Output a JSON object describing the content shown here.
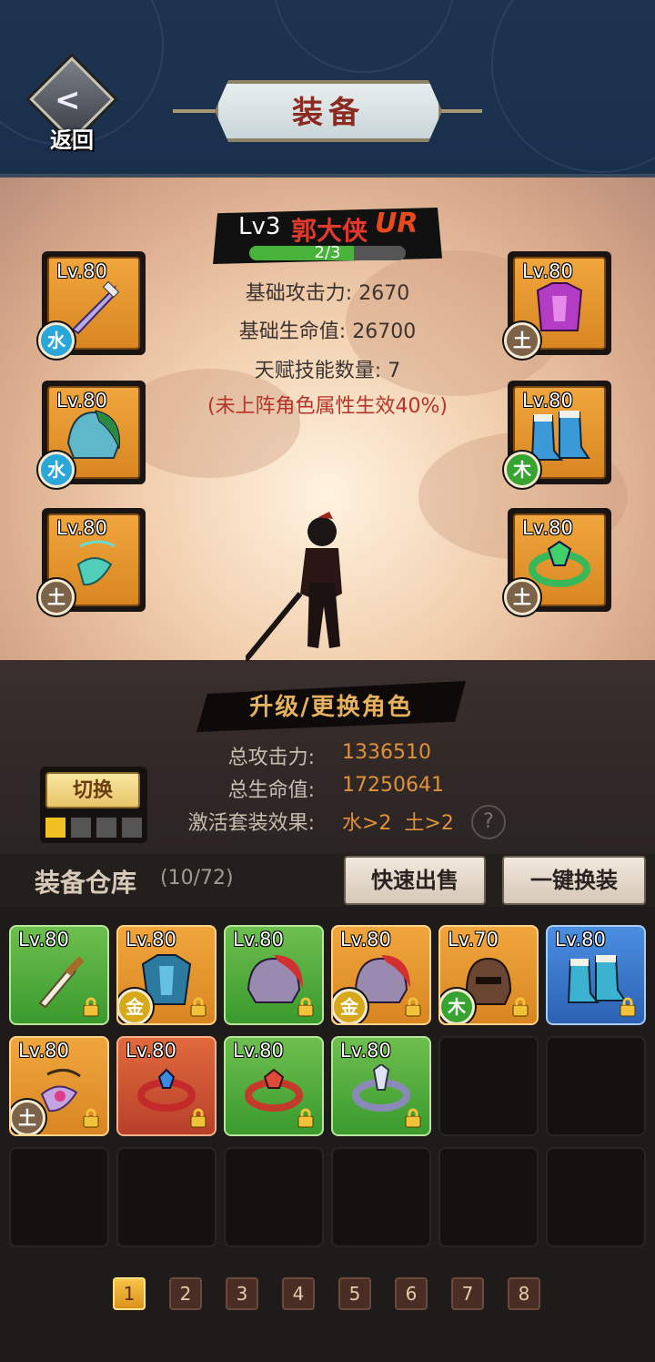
{
  "header": {
    "title": "装备",
    "back_label": "返回"
  },
  "hero": {
    "level": "Lv3",
    "name": "郭大侠",
    "rarity": "UR",
    "progress_text": "2/3",
    "progress": 0.6667,
    "stats": [
      "基础攻击力: 2670",
      "基础生命值: 26700",
      "天赋技能数量: 7"
    ],
    "note": "(未上阵角色属性生效40%)"
  },
  "equipped": [
    {
      "level": "Lv.80",
      "element": "水",
      "item": "sword-icon"
    },
    {
      "level": "Lv.80",
      "element": "水",
      "item": "helmet-icon"
    },
    {
      "level": "Lv.80",
      "element": "土",
      "item": "pendant-icon"
    },
    {
      "level": "Lv.80",
      "element": "土",
      "item": "armor-icon"
    },
    {
      "level": "Lv.80",
      "element": "木",
      "item": "boots-icon"
    },
    {
      "level": "Lv.80",
      "element": "土",
      "item": "ring-icon"
    }
  ],
  "action": {
    "label": "升级/更换角色"
  },
  "summary": {
    "attack_label": "总攻击力:",
    "attack_value": "1336510",
    "hp_label": "总生命值:",
    "hp_value": "17250641",
    "set_label": "激活套装效果:",
    "set_value": "水>2  土>2",
    "help": "?"
  },
  "switch": {
    "label": "切换",
    "active_index": 0,
    "slots": 4
  },
  "warehouse": {
    "title": "装备仓库",
    "count": "(10/72)",
    "quick_sell": "快速出售",
    "one_click_equip": "一键换装",
    "items": [
      {
        "level": "Lv.80",
        "quality": "green",
        "element": "",
        "item": "dagger-icon"
      },
      {
        "level": "Lv.80",
        "quality": "orange",
        "element": "金",
        "item": "armor-icon"
      },
      {
        "level": "Lv.80",
        "quality": "green",
        "element": "",
        "item": "helmet-icon"
      },
      {
        "level": "Lv.80",
        "quality": "orange",
        "element": "金",
        "item": "helmet-icon"
      },
      {
        "level": "Lv.70",
        "quality": "orange",
        "element": "木",
        "item": "helmet-icon"
      },
      {
        "level": "Lv.80",
        "quality": "blue",
        "element": "",
        "item": "boots-icon"
      },
      {
        "level": "Lv.80",
        "quality": "orange",
        "element": "土",
        "item": "pendant-icon"
      },
      {
        "level": "Lv.80",
        "quality": "red",
        "element": "",
        "item": "ring-icon"
      },
      {
        "level": "Lv.80",
        "quality": "green",
        "element": "",
        "item": "ring-icon"
      },
      {
        "level": "Lv.80",
        "quality": "green",
        "element": "",
        "item": "ring-icon"
      }
    ]
  },
  "pagination": {
    "pages": [
      "1",
      "2",
      "3",
      "4",
      "5",
      "6",
      "7",
      "8"
    ],
    "current": "1"
  },
  "colors": {
    "header_bg": "#1f3350",
    "accent_orange": "#e0913a",
    "hero_name": "#e03a2e",
    "note_red": "#b4342a"
  }
}
